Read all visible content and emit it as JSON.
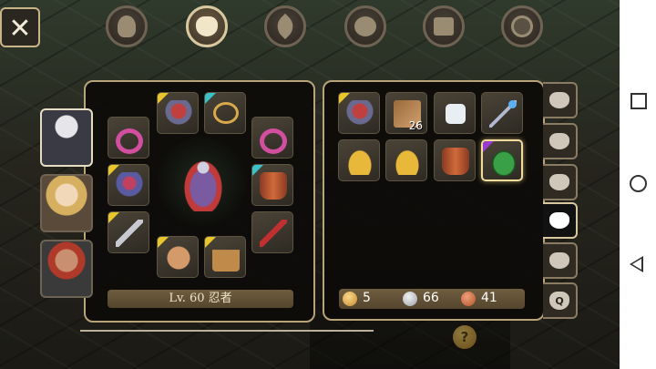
{
  "close_button": {
    "label": "✕"
  },
  "top_tabs": [
    {
      "name": "character",
      "icon": "head-icon"
    },
    {
      "name": "bag",
      "icon": "bag-icon",
      "active": true
    },
    {
      "name": "skills",
      "icon": "leaf-icon"
    },
    {
      "name": "party",
      "icon": "people-icon"
    },
    {
      "name": "quests",
      "icon": "scroll-icon"
    },
    {
      "name": "settings",
      "icon": "gear-icon"
    }
  ],
  "equipment": {
    "level_label": "Lv. 60 忍者",
    "slots": [
      {
        "item": "armor",
        "rarity": "yellow"
      },
      {
        "item": "ring",
        "rarity": "none"
      },
      {
        "item": "necklace",
        "rarity": "cyan"
      },
      {
        "item": "ring",
        "rarity": "none"
      },
      {
        "item": "robot-armor",
        "rarity": "yellow"
      },
      {
        "item": "vest",
        "rarity": "cyan"
      },
      {
        "item": "blade",
        "rarity": "yellow"
      },
      {
        "item": "red-blade",
        "rarity": "none"
      },
      {
        "item": "gloves",
        "rarity": "yellow"
      },
      {
        "item": "boots",
        "rarity": "yellow"
      }
    ]
  },
  "inventory": {
    "items": [
      {
        "item": "armor",
        "rarity": "yellow",
        "qty": ""
      },
      {
        "item": "map",
        "rarity": "none",
        "qty": "26"
      },
      {
        "item": "dice",
        "rarity": "none",
        "qty": ""
      },
      {
        "item": "staff",
        "rarity": "none",
        "qty": ""
      },
      {
        "item": "lamp",
        "rarity": "none",
        "qty": ""
      },
      {
        "item": "lamp",
        "rarity": "none",
        "qty": ""
      },
      {
        "item": "vest",
        "rarity": "none",
        "qty": ""
      },
      {
        "item": "egg",
        "rarity": "purple",
        "qty": "",
        "selected": true
      }
    ]
  },
  "currency": {
    "gold": "5",
    "silver": "66",
    "copper": "41"
  },
  "bag_tabs": [
    {
      "label": ""
    },
    {
      "label": ""
    },
    {
      "label": ""
    },
    {
      "label": "",
      "active": true
    },
    {
      "label": ""
    },
    {
      "label": "Q"
    }
  ],
  "deco": {
    "quest_marker": "?"
  },
  "colors": {
    "panel_border": "#b9a47a",
    "rarity_yellow": "#e8c62c",
    "rarity_cyan": "#3ac2c8",
    "rarity_purple": "#9b3ad0"
  }
}
